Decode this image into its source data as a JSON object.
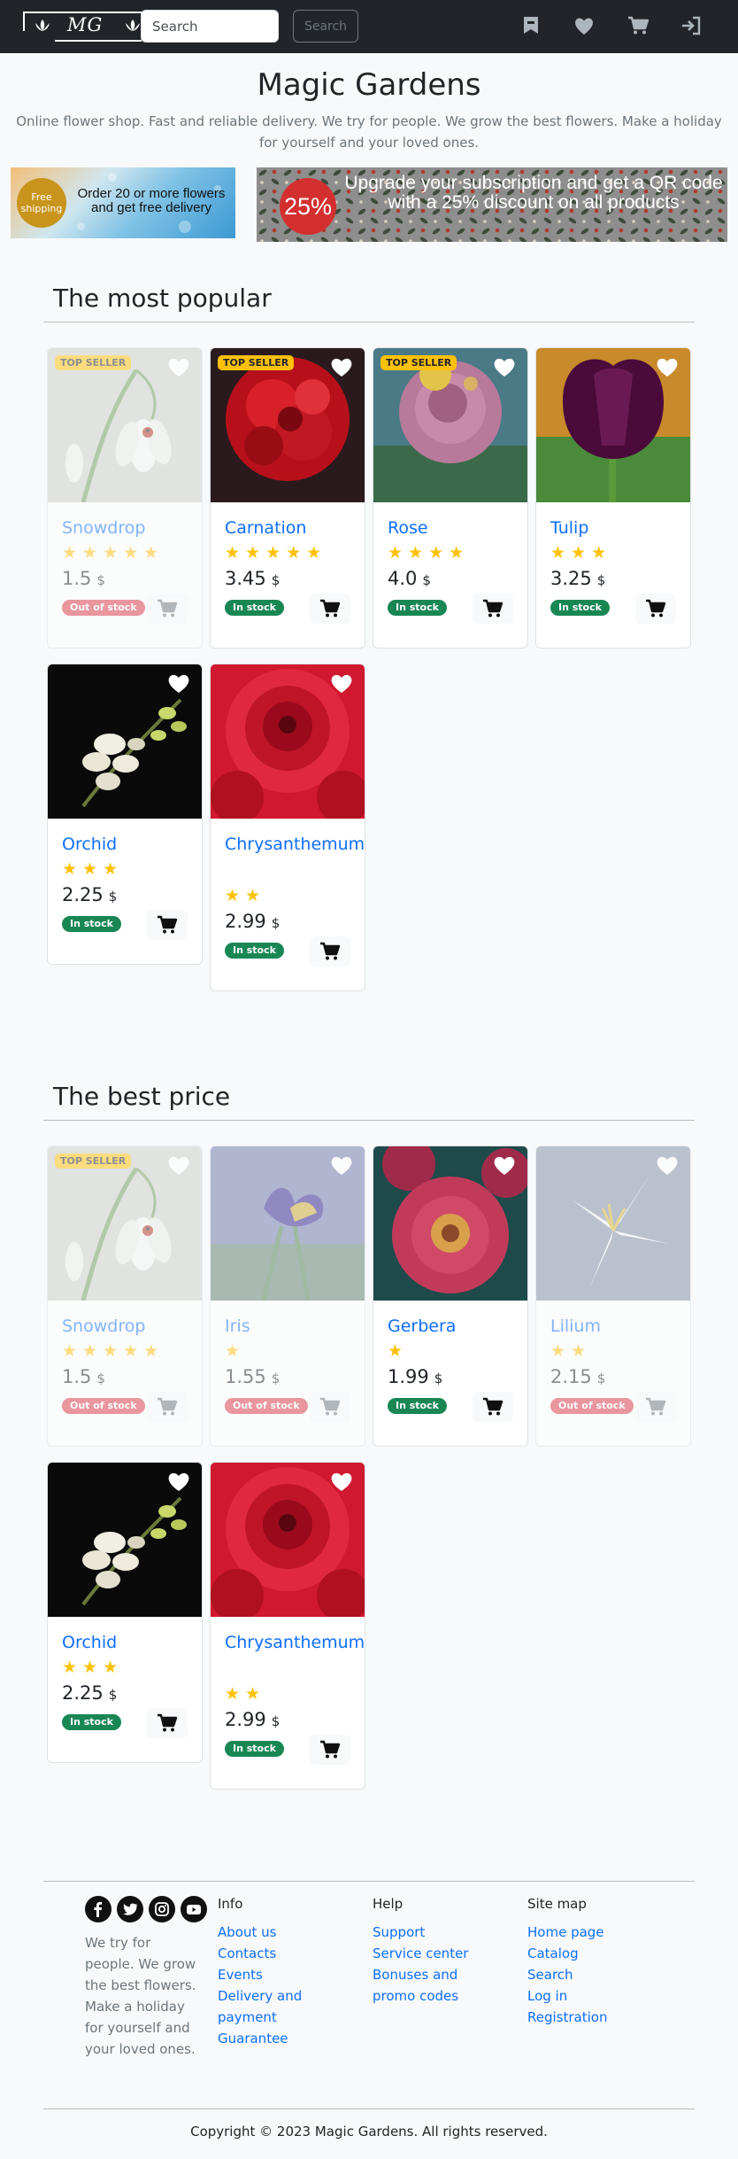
{
  "header": {
    "logo_text": "MG",
    "search_placeholder": "Search",
    "search_button": "Search"
  },
  "hero": {
    "title": "Magic Gardens",
    "description": "Online flower shop. Fast and reliable delivery. We try for people. We grow the best flowers. Make a holiday for yourself and your loved ones."
  },
  "banners": {
    "shipping_badge": "Free shipping",
    "shipping_text": "Order 20 or more flowers and get free delivery",
    "discount_badge": "25%",
    "discount_text": "Upgrade your subscription and get a QR code with a 25% discount on all products"
  },
  "popular": {
    "title": "The most popular",
    "products": [
      {
        "name": "Snowdrop",
        "rating": 5,
        "price": "1.5",
        "currency": "$",
        "status": "Out of stock",
        "in_stock": false,
        "top_seller": true,
        "image": "snowdrop"
      },
      {
        "name": "Carnation",
        "rating": 5,
        "price": "3.45",
        "currency": "$",
        "status": "In stock",
        "in_stock": true,
        "top_seller": true,
        "image": "carnation"
      },
      {
        "name": "Rose",
        "rating": 4,
        "price": "4.0",
        "currency": "$",
        "status": "In stock",
        "in_stock": true,
        "top_seller": true,
        "image": "rose"
      },
      {
        "name": "Tulip",
        "rating": 3,
        "price": "3.25",
        "currency": "$",
        "status": "In stock",
        "in_stock": true,
        "top_seller": false,
        "image": "tulip"
      },
      {
        "name": "Orchid",
        "rating": 3,
        "price": "2.25",
        "currency": "$",
        "status": "In stock",
        "in_stock": true,
        "top_seller": false,
        "image": "orchid"
      },
      {
        "name": "Chrysanthemum",
        "rating": 2,
        "price": "2.99",
        "currency": "$",
        "status": "In stock",
        "in_stock": true,
        "top_seller": false,
        "image": "chrysanthemum"
      }
    ]
  },
  "best_price": {
    "title": "The best price",
    "products": [
      {
        "name": "Snowdrop",
        "rating": 5,
        "price": "1.5",
        "currency": "$",
        "status": "Out of stock",
        "in_stock": false,
        "top_seller": true,
        "image": "snowdrop"
      },
      {
        "name": "Iris",
        "rating": 1,
        "price": "1.55",
        "currency": "$",
        "status": "Out of stock",
        "in_stock": false,
        "top_seller": false,
        "image": "iris"
      },
      {
        "name": "Gerbera",
        "rating": 1,
        "price": "1.99",
        "currency": "$",
        "status": "In stock",
        "in_stock": true,
        "top_seller": false,
        "image": "gerbera"
      },
      {
        "name": "Lilium",
        "rating": 2,
        "price": "2.15",
        "currency": "$",
        "status": "Out of stock",
        "in_stock": false,
        "top_seller": false,
        "image": "lilium"
      },
      {
        "name": "Orchid",
        "rating": 3,
        "price": "2.25",
        "currency": "$",
        "status": "In stock",
        "in_stock": true,
        "top_seller": false,
        "image": "orchid"
      },
      {
        "name": "Chrysanthemum",
        "rating": 2,
        "price": "2.99",
        "currency": "$",
        "status": "In stock",
        "in_stock": true,
        "top_seller": false,
        "image": "chrysanthemum"
      }
    ]
  },
  "labels": {
    "top_seller": "TOP SELLER"
  },
  "footer": {
    "about": "We try for people. We grow the best flowers. Make a holiday for yourself and your loved ones.",
    "social_icons": [
      "facebook-icon",
      "twitter-icon",
      "instagram-icon",
      "youtube-icon"
    ],
    "columns": [
      {
        "title": "Info",
        "links": [
          "About us",
          "Contacts",
          "Events",
          "Delivery and payment",
          "Guarantee"
        ]
      },
      {
        "title": "Help",
        "links": [
          "Support",
          "Service center",
          "Bonuses and promo codes"
        ]
      },
      {
        "title": "Site map",
        "links": [
          "Home page",
          "Catalog",
          "Search",
          "Log in",
          "Registration"
        ]
      }
    ],
    "copyright": "Copyright © 2023 Magic Gardens. All rights reserved."
  },
  "colors": {
    "navbar": "#212529",
    "link": "#0d6efd",
    "star": "#ffc107",
    "in_stock": "#198754",
    "out_of_stock": "#dc3545"
  }
}
